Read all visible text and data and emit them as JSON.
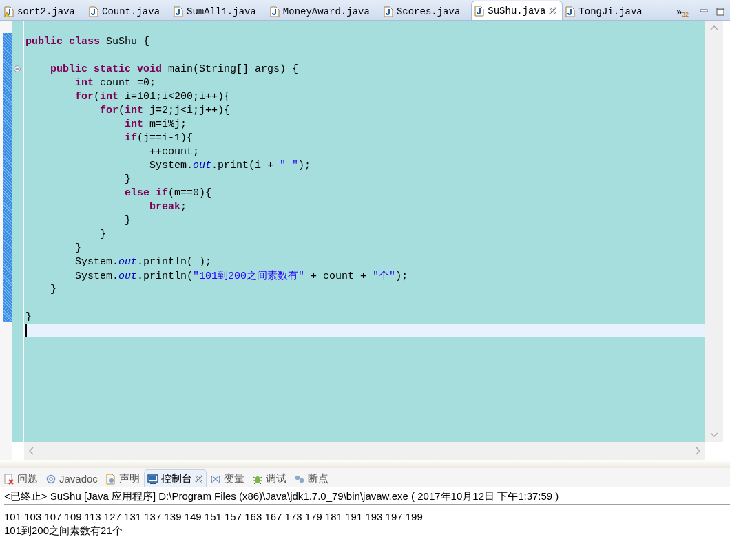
{
  "editor_tabs": [
    {
      "label": "sort2.java",
      "selected": false,
      "warning": true
    },
    {
      "label": "Count.java",
      "selected": false,
      "warning": false
    },
    {
      "label": "SumAll1.java",
      "selected": false,
      "warning": false
    },
    {
      "label": "MoneyAward.java",
      "selected": false,
      "warning": false
    },
    {
      "label": "Scores.java",
      "selected": false,
      "warning": false
    },
    {
      "label": "SuShu.java",
      "selected": true,
      "warning": false
    },
    {
      "label": "TongJi.java",
      "selected": false,
      "warning": false
    }
  ],
  "overflow": {
    "glyph": "»",
    "count": "32"
  },
  "code_lines": [
    {
      "kind": "blank",
      "current": false,
      "fold": false
    },
    {
      "kind": "code",
      "current": false,
      "fold": false,
      "tokens": [
        {
          "kind": "keyword",
          "text": "public class "
        },
        {
          "kind": "plain",
          "text": "SuShu {"
        }
      ]
    },
    {
      "kind": "blank",
      "current": false,
      "fold": false
    },
    {
      "kind": "code",
      "current": false,
      "fold": true,
      "tokens": [
        {
          "kind": "keyword",
          "text": "    public static void "
        },
        {
          "kind": "plain",
          "text": "main(String[] args) {"
        }
      ]
    },
    {
      "kind": "code",
      "current": false,
      "fold": false,
      "tokens": [
        {
          "kind": "keyword",
          "text": "        int "
        },
        {
          "kind": "plain",
          "text": "count =0;"
        }
      ]
    },
    {
      "kind": "code",
      "current": false,
      "fold": false,
      "tokens": [
        {
          "kind": "keyword",
          "text": "        for"
        },
        {
          "kind": "plain",
          "text": "("
        },
        {
          "kind": "keyword",
          "text": "int "
        },
        {
          "kind": "plain",
          "text": "i=101;i<200;i++){"
        }
      ]
    },
    {
      "kind": "code",
      "current": false,
      "fold": false,
      "tokens": [
        {
          "kind": "keyword",
          "text": "            for"
        },
        {
          "kind": "plain",
          "text": "("
        },
        {
          "kind": "keyword",
          "text": "int "
        },
        {
          "kind": "plain",
          "text": "j=2;j<i;j++){"
        }
      ]
    },
    {
      "kind": "code",
      "current": false,
      "fold": false,
      "tokens": [
        {
          "kind": "keyword",
          "text": "                int "
        },
        {
          "kind": "plain",
          "text": "m=i%j;"
        }
      ]
    },
    {
      "kind": "code",
      "current": false,
      "fold": false,
      "tokens": [
        {
          "kind": "keyword",
          "text": "                if"
        },
        {
          "kind": "plain",
          "text": "(j==i-1){"
        }
      ]
    },
    {
      "kind": "code",
      "current": false,
      "fold": false,
      "tokens": [
        {
          "kind": "plain",
          "text": "                    ++count;"
        }
      ]
    },
    {
      "kind": "code",
      "current": false,
      "fold": false,
      "tokens": [
        {
          "kind": "plain",
          "text": "                    System."
        },
        {
          "kind": "field",
          "text": "out"
        },
        {
          "kind": "plain",
          "text": ".print(i + "
        },
        {
          "kind": "string",
          "text": "\" \""
        },
        {
          "kind": "plain",
          "text": ");"
        }
      ]
    },
    {
      "kind": "code",
      "current": false,
      "fold": false,
      "tokens": [
        {
          "kind": "plain",
          "text": "                }"
        }
      ]
    },
    {
      "kind": "code",
      "current": false,
      "fold": false,
      "tokens": [
        {
          "kind": "keyword",
          "text": "                else if"
        },
        {
          "kind": "plain",
          "text": "(m==0){"
        }
      ]
    },
    {
      "kind": "code",
      "current": false,
      "fold": false,
      "tokens": [
        {
          "kind": "keyword",
          "text": "                    break"
        },
        {
          "kind": "plain",
          "text": ";"
        }
      ]
    },
    {
      "kind": "code",
      "current": false,
      "fold": false,
      "tokens": [
        {
          "kind": "plain",
          "text": "                }"
        }
      ]
    },
    {
      "kind": "code",
      "current": false,
      "fold": false,
      "tokens": [
        {
          "kind": "plain",
          "text": "            }"
        }
      ]
    },
    {
      "kind": "code",
      "current": false,
      "fold": false,
      "tokens": [
        {
          "kind": "plain",
          "text": "        }"
        }
      ]
    },
    {
      "kind": "code",
      "current": false,
      "fold": false,
      "tokens": [
        {
          "kind": "plain",
          "text": "        System."
        },
        {
          "kind": "field",
          "text": "out"
        },
        {
          "kind": "plain",
          "text": ".println( );"
        }
      ]
    },
    {
      "kind": "code",
      "current": false,
      "fold": false,
      "tokens": [
        {
          "kind": "plain",
          "text": "        System."
        },
        {
          "kind": "field",
          "text": "out"
        },
        {
          "kind": "plain",
          "text": ".println("
        },
        {
          "kind": "string",
          "text": "\"101到200之间素数有\""
        },
        {
          "kind": "plain",
          "text": " + count + "
        },
        {
          "kind": "string",
          "text": "\"个\""
        },
        {
          "kind": "plain",
          "text": ");"
        }
      ]
    },
    {
      "kind": "code",
      "current": false,
      "fold": false,
      "tokens": [
        {
          "kind": "plain",
          "text": "    }"
        }
      ]
    },
    {
      "kind": "blank",
      "current": false,
      "fold": false
    },
    {
      "kind": "code",
      "current": false,
      "fold": false,
      "tokens": [
        {
          "kind": "plain",
          "text": "}"
        }
      ]
    },
    {
      "kind": "blank",
      "current": true,
      "fold": false
    }
  ],
  "panel_tabs": [
    {
      "label": "问题",
      "kind": "problems",
      "selected": false
    },
    {
      "label": "Javadoc",
      "kind": "javadoc",
      "selected": false
    },
    {
      "label": "声明",
      "kind": "declaration",
      "selected": false
    },
    {
      "label": "控制台",
      "kind": "console",
      "selected": true
    },
    {
      "label": "变量",
      "kind": "variables",
      "selected": false
    },
    {
      "label": "调试",
      "kind": "debug",
      "selected": false
    },
    {
      "label": "断点",
      "kind": "breakpoints",
      "selected": false
    }
  ],
  "console": {
    "header": "<已终止> SuShu [Java 应用程序] D:\\Program Files (x86)\\Java\\jdk1.7.0_79\\bin\\javaw.exe ( 2017年10月12日 下午1:37:59 )",
    "output": [
      "101 103 107 109 113 127 131 137 139 149 151 157 163 167 173 179 181 191 193 197 199",
      "101到200之间素数有21个"
    ]
  }
}
